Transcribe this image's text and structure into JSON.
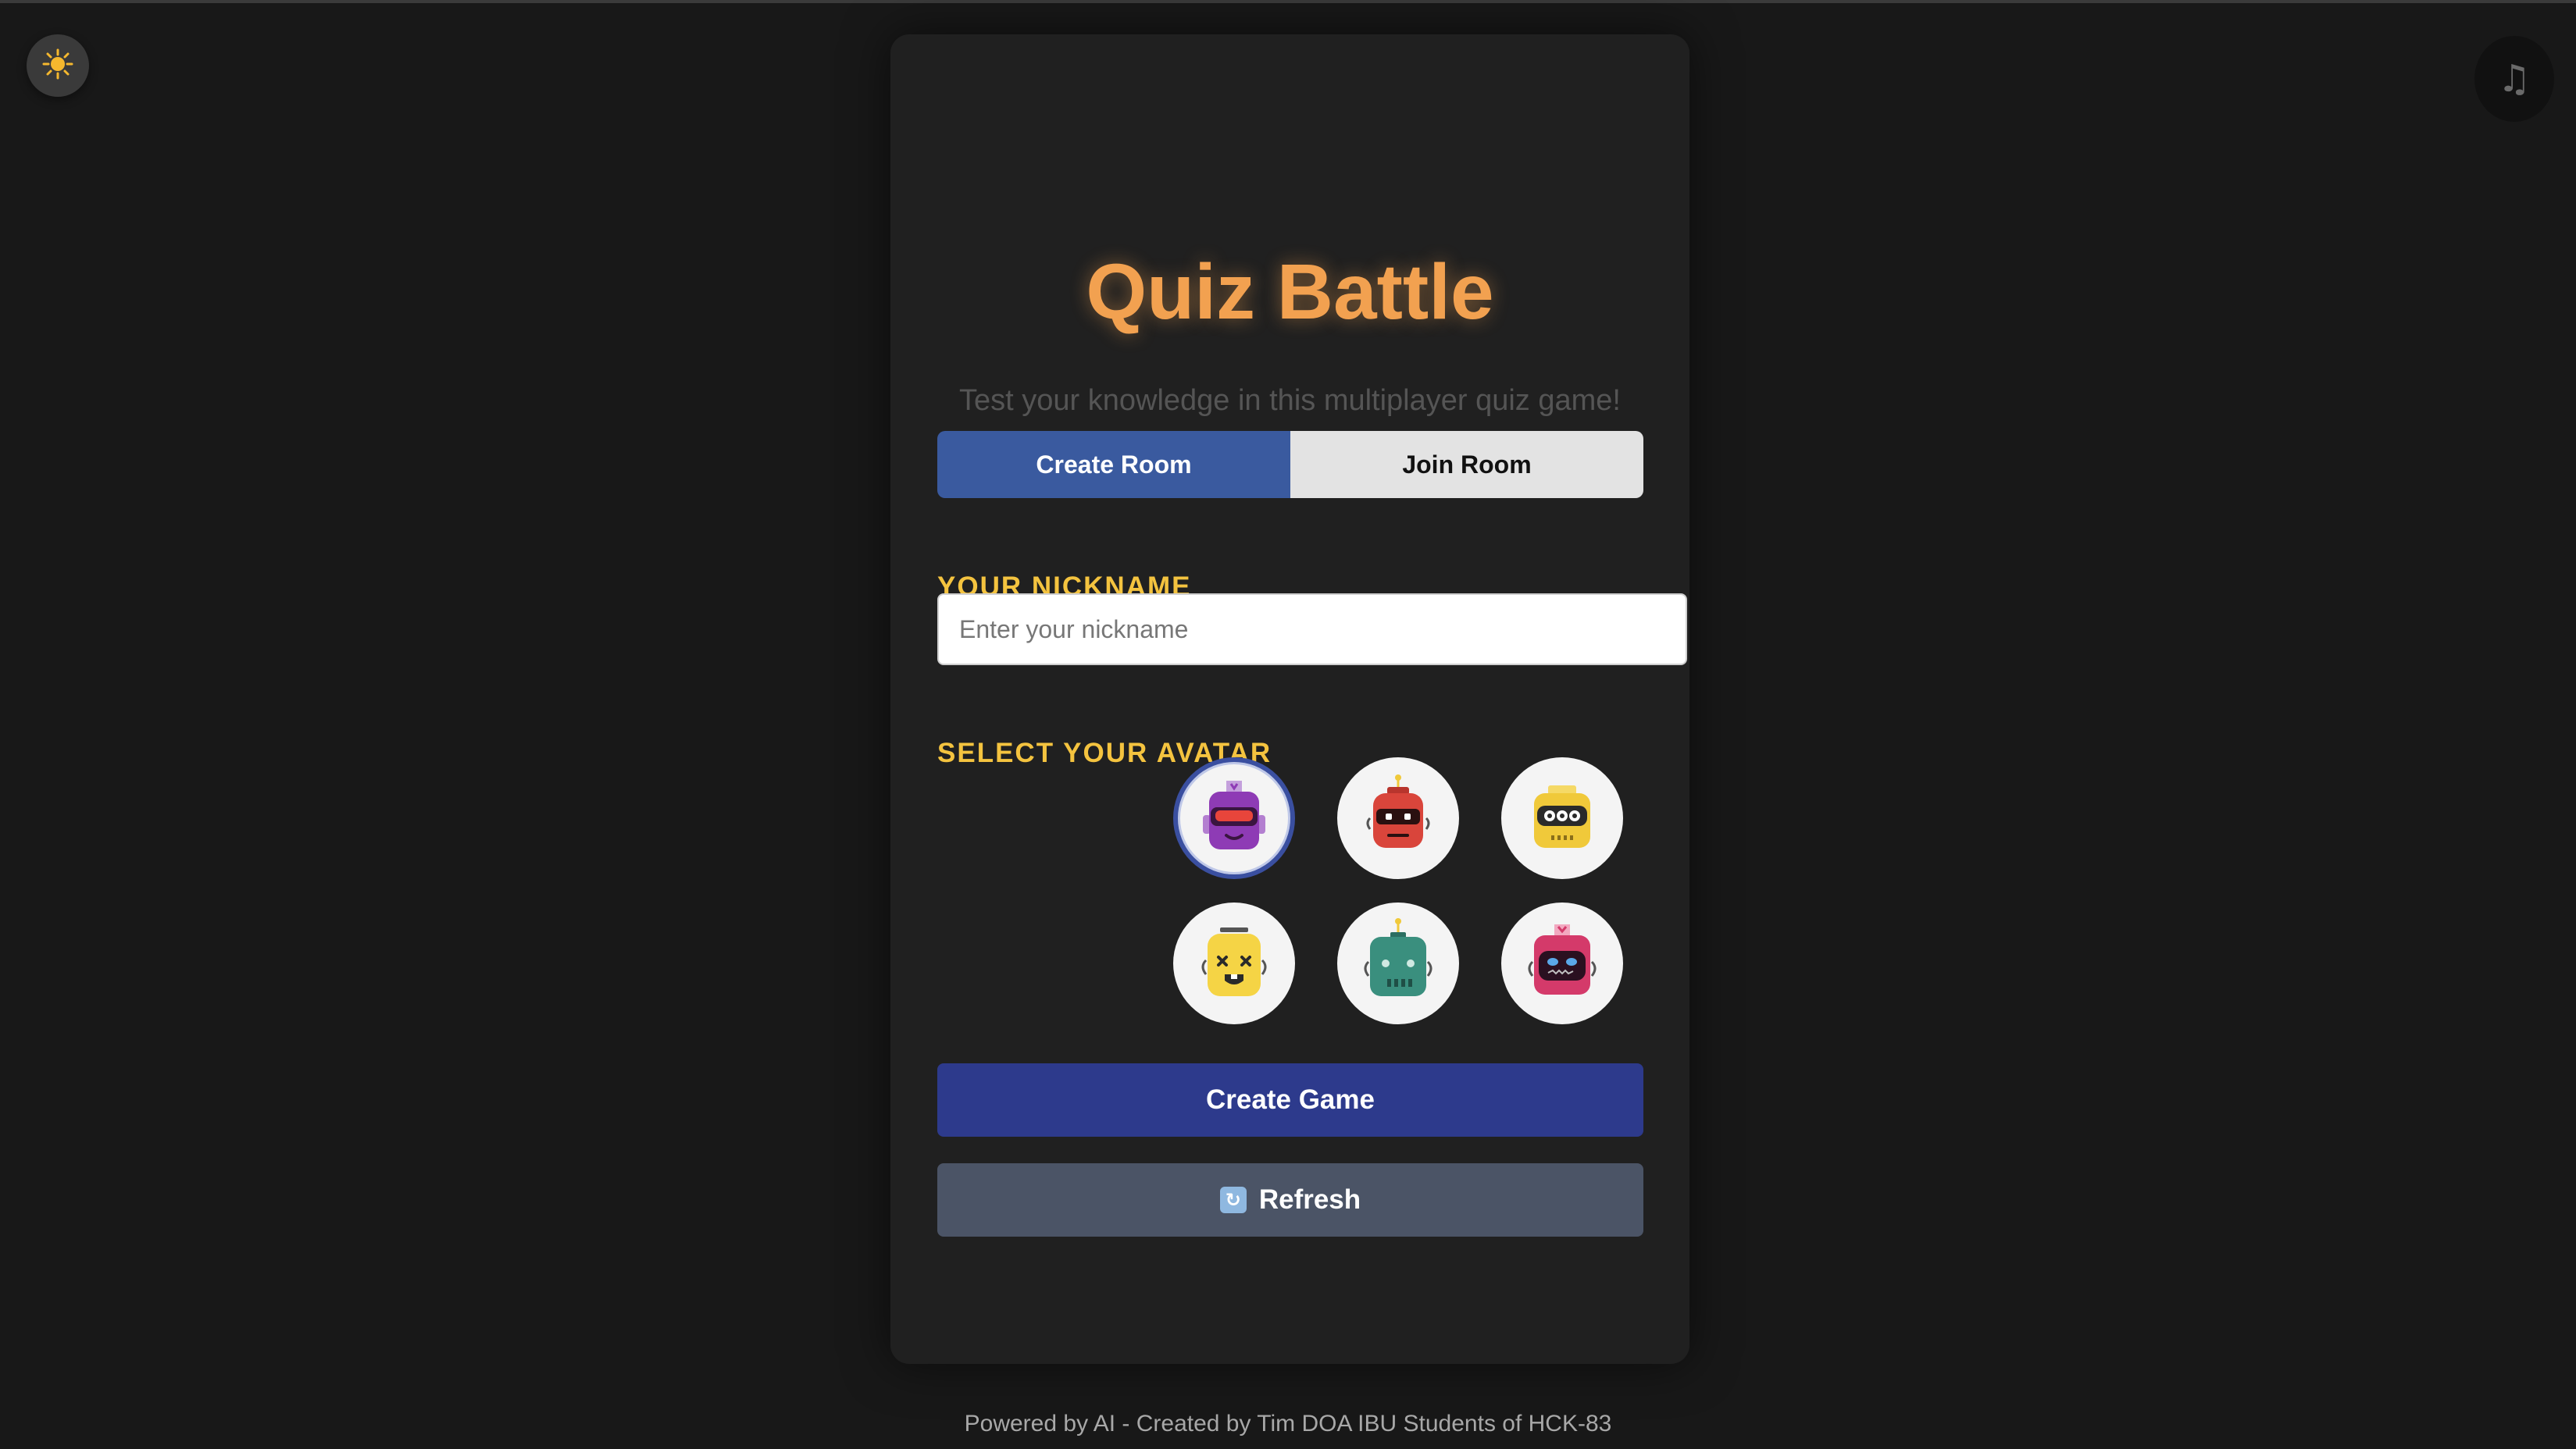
{
  "header": {
    "theme_toggle_icon": "sun-icon",
    "music_toggle_icon": "music-note-icon",
    "music_glyph": "♫"
  },
  "card": {
    "title": "Quiz Battle",
    "subtitle": "Test your knowledge in this multiplayer quiz game!",
    "tabs": [
      {
        "label": "Create Room",
        "active": true
      },
      {
        "label": "Join Room",
        "active": false
      }
    ],
    "nickname": {
      "label": "YOUR NICKNAME",
      "placeholder": "Enter your nickname",
      "value": ""
    },
    "avatar": {
      "label": "SELECT YOUR AVATAR",
      "options": [
        {
          "name": "purple-robot",
          "color": "#8e3bb5",
          "selected": true
        },
        {
          "name": "red-robot",
          "color": "#d9453b",
          "selected": false
        },
        {
          "name": "yellow-robot",
          "color": "#f0c93a",
          "selected": false
        },
        {
          "name": "yellow-dizzy-robot",
          "color": "#f5d445",
          "selected": false
        },
        {
          "name": "teal-robot",
          "color": "#3a8f7e",
          "selected": false
        },
        {
          "name": "pink-robot",
          "color": "#d43a6a",
          "selected": false
        }
      ]
    },
    "create_button": "Create Game",
    "refresh_button": "Refresh",
    "refresh_icon": "refresh-icon"
  },
  "footer": {
    "text": "Powered by AI - Created by Tim DOA IBU Students of HCK-83"
  },
  "colors": {
    "background": "#181818",
    "card": "#202020",
    "title": "#f2a150",
    "label": "#f4c33f",
    "tab_active": "#3a5a9f",
    "create_button": "#2d3a8c",
    "refresh_button": "#4b5466"
  }
}
